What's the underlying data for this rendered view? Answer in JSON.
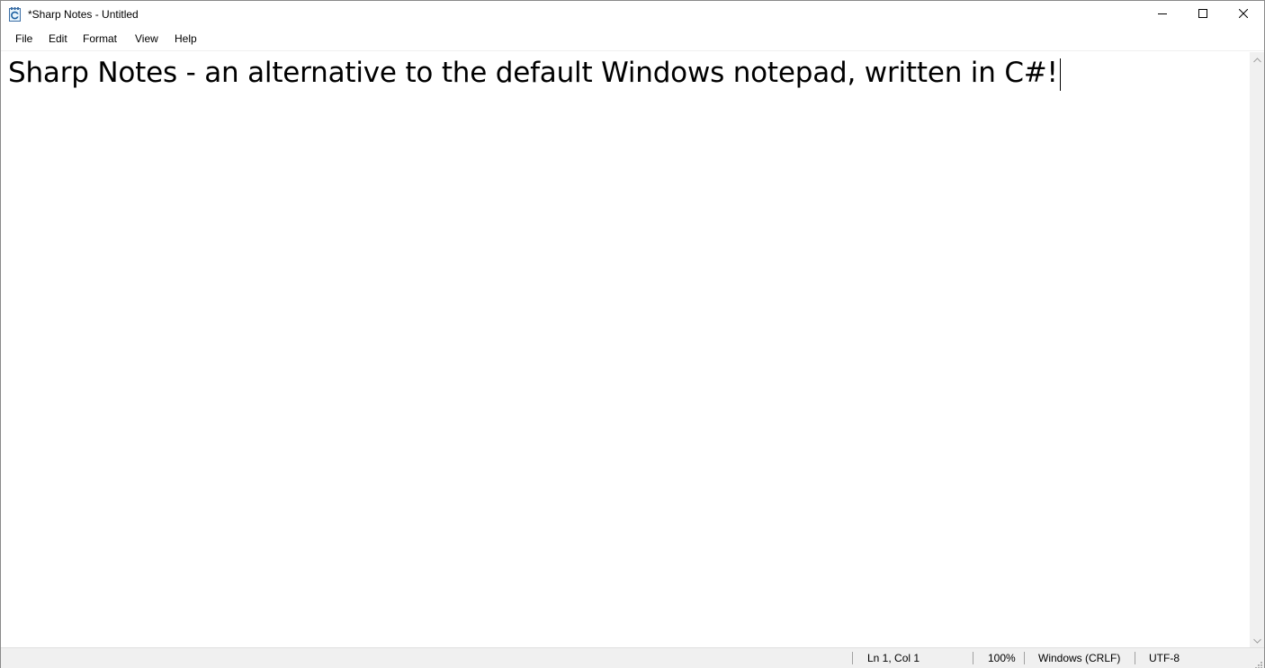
{
  "window": {
    "title": "*Sharp Notes - Untitled"
  },
  "menu": {
    "items": [
      "File",
      "Edit",
      "Format",
      "View",
      "Help"
    ]
  },
  "editor": {
    "content": "Sharp Notes - an alternative to the default Windows notepad, written in C#!"
  },
  "status": {
    "position": "Ln 1, Col 1",
    "zoom": "100%",
    "line_ending": "Windows (CRLF)",
    "encoding": "UTF-8"
  },
  "icons": {
    "app": "notepad-app-icon",
    "minimize": "minimize-icon",
    "maximize": "maximize-icon",
    "close": "close-icon",
    "scroll_up": "scroll-up-arrow-icon",
    "scroll_down": "scroll-down-arrow-icon",
    "grip": "resize-grip-icon"
  },
  "colors": {
    "chrome": "#f0f0f0",
    "background": "#ffffff",
    "text": "#000000"
  }
}
